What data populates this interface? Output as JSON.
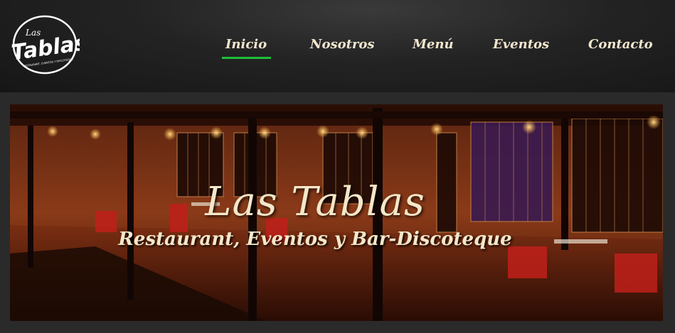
{
  "brand": {
    "logo_text": "Las Tablas",
    "logo_small": "Las",
    "logo_big": "Tablas",
    "logo_tagline": "RESTAURANT, EVENTOS Y DISCOTEQUE"
  },
  "nav": {
    "items": [
      {
        "label": "Inicio",
        "active": true
      },
      {
        "label": "Nosotros",
        "active": false
      },
      {
        "label": "Menú",
        "active": false
      },
      {
        "label": "Eventos",
        "active": false
      },
      {
        "label": "Contacto",
        "active": false
      }
    ],
    "active_color": "#1fbf3a",
    "text_color": "#f2e6cf"
  },
  "hero": {
    "title": "Las Tablas",
    "subtitle": "Restaurant, Eventos y Bar-Discoteque"
  }
}
